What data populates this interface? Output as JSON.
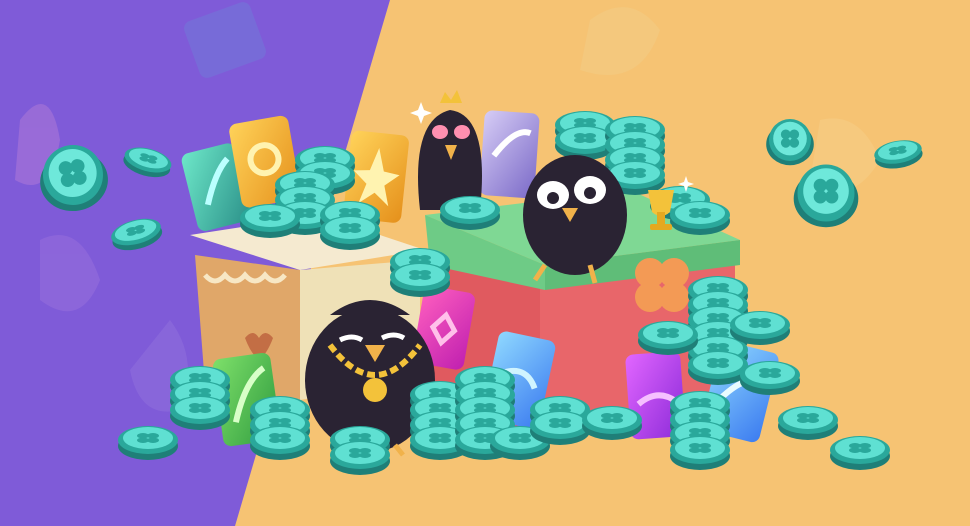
{
  "scene": {
    "colors": {
      "bg_left": "#7f5bd8",
      "bg_left_shade": "#6a48c4",
      "bg_right": "#f6c373",
      "bg_right_shade": "#f0b35e",
      "coin_face": "#5fe0d2",
      "coin_rim": "#2aa89b",
      "coin_dark": "#1f7f78",
      "crow_body": "#2a2333",
      "crow_beak": "#f1b24a",
      "gold": "#f3c23a",
      "box_cream": "#efe1b7",
      "box_cream_side": "#e0a769",
      "box_green": "#6ecb86",
      "box_red": "#e05a5f"
    },
    "icons": [
      "clover-coin-icon",
      "crow-character-icon",
      "crown-icon",
      "trophy-icon",
      "gold-chain-icon",
      "card-icon",
      "gift-box-icon",
      "sparkle-icon"
    ]
  }
}
